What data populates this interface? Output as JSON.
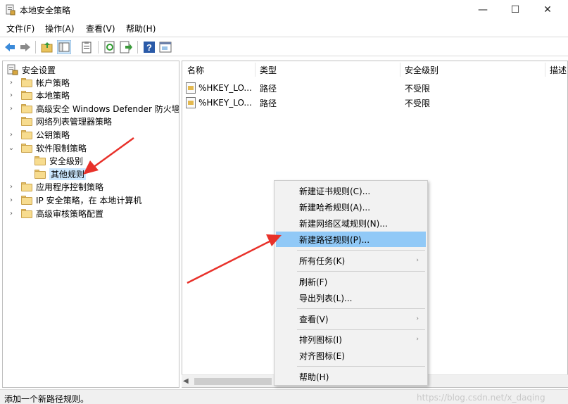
{
  "window": {
    "title": "本地安全策略",
    "min_glyph": "—",
    "max_glyph": "☐",
    "close_glyph": "✕"
  },
  "menu": {
    "items": [
      "文件(F)",
      "操作(A)",
      "查看(V)",
      "帮助(H)"
    ]
  },
  "toolbar": {
    "buttons": [
      "back-icon",
      "forward-icon",
      "up-folder-icon",
      "show-tree-icon",
      "properties-icon",
      "refresh-icon",
      "export-icon",
      "help-icon",
      "console-icon"
    ]
  },
  "tree": {
    "root": "安全设置",
    "items": [
      {
        "label": "帐户策略",
        "expander": "›"
      },
      {
        "label": "本地策略",
        "expander": "›"
      },
      {
        "label": "高级安全 Windows Defender 防火墙",
        "expander": "›"
      },
      {
        "label": "网络列表管理器策略",
        "expander": ""
      },
      {
        "label": "公钥策略",
        "expander": "›"
      },
      {
        "label": "软件限制策略",
        "expander": "⌄"
      },
      {
        "label": "安全级别",
        "expander": ""
      },
      {
        "label": "其他规则",
        "expander": ""
      },
      {
        "label": "应用程序控制策略",
        "expander": "›"
      },
      {
        "label": "IP 安全策略，在 本地计算机",
        "expander": "›"
      },
      {
        "label": "高级审核策略配置",
        "expander": "›"
      }
    ]
  },
  "list": {
    "columns": [
      "名称",
      "类型",
      "安全级别",
      "描述"
    ],
    "rows": [
      {
        "name": "%HKEY_LO...",
        "type": "路径",
        "level": "不受限"
      },
      {
        "name": "%HKEY_LO...",
        "type": "路径",
        "level": "不受限"
      }
    ]
  },
  "context_menu": {
    "items": [
      "新建证书规则(C)...",
      "新建哈希规则(A)...",
      "新建网络区域规则(N)...",
      "新建路径规则(P)...",
      "所有任务(K)",
      "刷新(F)",
      "导出列表(L)...",
      "查看(V)",
      "排列图标(I)",
      "对齐图标(E)",
      "帮助(H)"
    ],
    "submenu_glyph": "›"
  },
  "status": {
    "text": "添加一个新路径规则。",
    "watermark": "https://blog.csdn.net/x_daqing"
  },
  "colors": {
    "highlight": "#91c9f7",
    "selection": "#cce8ff",
    "annotation_arrow": "#e8312a"
  }
}
